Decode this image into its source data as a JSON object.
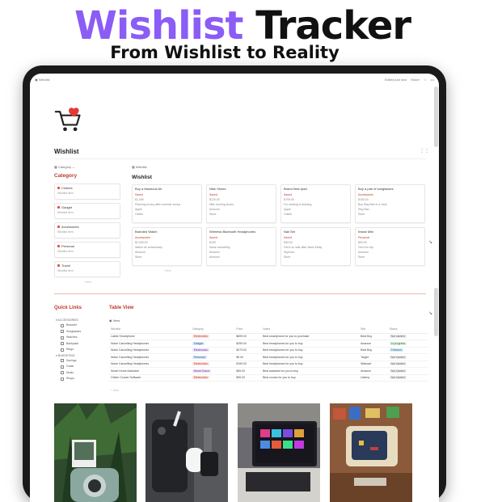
{
  "banner": {
    "title_part1": "Wishlist",
    "title_part2": "Tracker",
    "subtitle": "From Wishlist to Reality"
  },
  "topbar": {
    "left": "Wishlist",
    "right_items": [
      "Edited just now",
      "Share",
      "☆",
      "•••"
    ]
  },
  "page": {
    "title": "Wishlist"
  },
  "category": {
    "filter_label": "Category",
    "title": "Category",
    "items": [
      {
        "name": "Clothes",
        "sub": "Wishlist item"
      },
      {
        "name": "Gadget",
        "sub": "Wishlist item"
      },
      {
        "name": "Accessories",
        "sub": "Wishlist item"
      },
      {
        "name": "Personal",
        "sub": "Wishlist item"
      },
      {
        "name": "Travel",
        "sub": "Wishlist item"
      }
    ],
    "new_label": "+ New"
  },
  "wishlist": {
    "filter_label": "Wishlist",
    "title": "Wishlist",
    "cards": [
      {
        "name": "Buy a Macbook Air",
        "status": "Saved",
        "price": "$1,099",
        "note": "Planning to buy after summer bonus",
        "brand": "Apple",
        "place": "Online"
      },
      {
        "name": "Nike Shoes",
        "status": "Saved",
        "price": "$120.00",
        "note": "Nike running shoes",
        "brand": "Amazon",
        "place": "Store"
      },
      {
        "name": "Brand New Ipad",
        "status": "Saved",
        "price": "$799.00",
        "note": "For reading & drawing",
        "brand": "Apple",
        "place": "Online"
      },
      {
        "name": "Buy a pair of sunglasses",
        "status": "Accessories",
        "price": "$150.00",
        "note": "Buy Ray-Ban in a Deal",
        "brand": "Ray-Ban",
        "place": "Store"
      },
      {
        "name": "Branded Watch",
        "status": "Accessories",
        "price": "$2,000.00",
        "note": "Watch for anniversary",
        "brand": "Amazon",
        "place": "Store"
      },
      {
        "name": "Wireless Bluetooth Headphones",
        "status": "Saved",
        "price": "$199",
        "note": "Noise cancelling",
        "brand": "Amazon",
        "place": "Amazon"
      },
      {
        "name": "Nail Set",
        "status": "Saved",
        "price": "$34.00",
        "note": "Get it on sale after black friday",
        "brand": "Sephora",
        "place": "Store"
      },
      {
        "name": "Instax Mini",
        "status": "Personal",
        "price": "$90.00",
        "note": "Get it for trip",
        "brand": "Amazon",
        "place": "Store"
      }
    ],
    "new_label": "+ New"
  },
  "quick_links": {
    "title": "Quick Links",
    "groups": [
      {
        "name": "▾ ACCESSORIES",
        "items": [
          "Bracelet",
          "Sunglasses",
          "Watches",
          "Backpack",
          "Rings"
        ]
      },
      {
        "name": "▾ BUDGETING",
        "items": [
          "Savings",
          "Goals",
          "Deals",
          "Shops"
        ]
      }
    ]
  },
  "table_view": {
    "title": "Table View",
    "view_label": "View",
    "columns": [
      "Wishlist",
      "Category",
      "Price",
      "Notes",
      "Site",
      "Status"
    ],
    "rows": [
      {
        "name": "Latest Smartphone",
        "category": "Electronics",
        "cat_tag": "red",
        "price": "$699.00",
        "note": "Best smartphone for you to purchase",
        "site": "Best Buy",
        "status": "Not started",
        "status_tag": "gray"
      },
      {
        "name": "Noise Cancelling Headphones",
        "category": "Gadget",
        "cat_tag": "blue",
        "price": "$299.00",
        "note": "Best headphones for you to buy",
        "site": "Amazon",
        "status": "In progress",
        "status_tag": "green"
      },
      {
        "name": "Noise Cancelling Headphones",
        "category": "Electronics",
        "cat_tag": "purple",
        "price": "$279.00",
        "note": "Best headphones for you to buy",
        "site": "Best Buy",
        "status": "Finished",
        "status_tag": "bluelt"
      },
      {
        "name": "Noise Cancelling Headphones",
        "category": "Personal",
        "cat_tag": "blue",
        "price": "$9.00",
        "note": "Best headphones for you to buy",
        "site": "Target",
        "status": "Not started",
        "status_tag": "gray"
      },
      {
        "name": "Noise Cancelling Headphones",
        "category": "Electronics",
        "cat_tag": "red",
        "price": "$199.00",
        "note": "Best headphones for you to buy",
        "site": "Walmart",
        "status": "Not started",
        "status_tag": "gray"
      },
      {
        "name": "Smart Home Assistant",
        "category": "Home Decor",
        "cat_tag": "purple",
        "price": "$59.00",
        "note": "Best assistant for you to buy",
        "site": "Amazon",
        "status": "Not started",
        "status_tag": "gray"
      },
      {
        "name": "Online Course Software",
        "category": "Electronics",
        "cat_tag": "red",
        "price": "$99.00",
        "note": "Best course for you to buy",
        "site": "Udemy",
        "status": "Not started",
        "status_tag": "gray"
      }
    ],
    "footer": "+ New"
  },
  "photos": [
    {
      "name": "instax-camera-photo"
    },
    {
      "name": "airpods-watch-photo"
    },
    {
      "name": "laptop-photo"
    },
    {
      "name": "retro-tv-photo"
    }
  ]
}
